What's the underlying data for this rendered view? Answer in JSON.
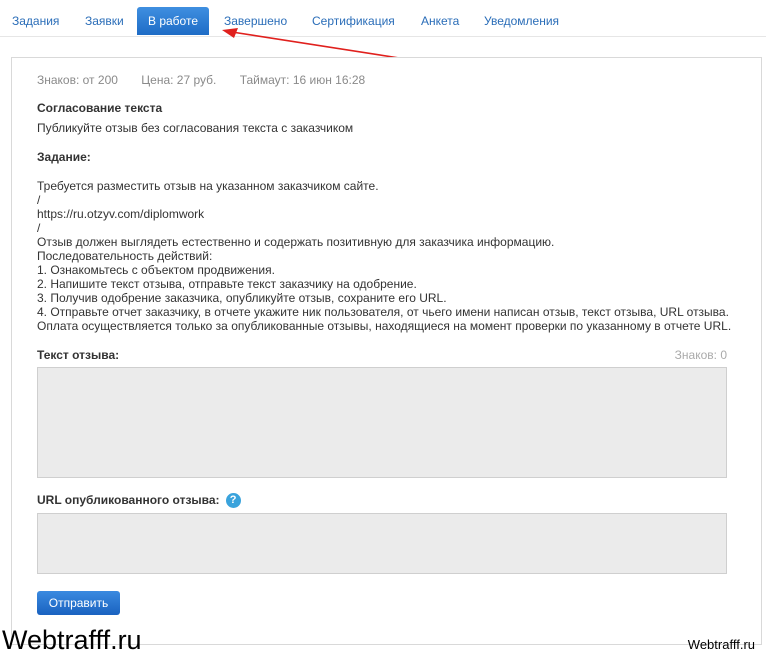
{
  "tabs": [
    {
      "label": "Задания"
    },
    {
      "label": "Заявки"
    },
    {
      "label": "В работе",
      "active": true
    },
    {
      "label": "Завершено"
    },
    {
      "label": "Сертификация"
    },
    {
      "label": "Анкета"
    },
    {
      "label": "Уведомления"
    }
  ],
  "accent_color": "#1e6cc6",
  "annotation_arrow_color": "#e0201d",
  "meta": {
    "chars": "Знаков: от 200",
    "price": "Цена: 27 руб.",
    "timeout": "Таймаут: 16 июн 16:28"
  },
  "approval": {
    "title": "Согласование текста",
    "text": "Публикуйте отзыв без согласования текста с заказчиком"
  },
  "task": {
    "title": "Задание:",
    "lines": [
      "Требуется разместить отзыв на указанном заказчиком сайте.",
      "/",
      "https://ru.otzyv.com/diplomwork",
      "/",
      "Отзыв должен выглядеть естественно и содержать позитивную для заказчика информацию.",
      "Последовательность действий:",
      "1. Ознакомьтесь с объектом продвижения.",
      "2. Напишите текст отзыва, отправьте текст заказчику на одобрение.",
      "3. Получив одобрение заказчика, опубликуйте отзыв, сохраните его URL.",
      "4. Отправьте отчет заказчику, в отчете укажите ник пользователя, от чьего имени написан отзыв, текст отзыва, URL отзыва.",
      "Оплата осуществляется только за опубликованные отзывы, находящиеся на момент проверки по указанному в отчете URL."
    ]
  },
  "review": {
    "label": "Текст отзыва:",
    "counter": "Знаков: 0",
    "value": ""
  },
  "url": {
    "label": "URL опубликованного отзыва:",
    "help_icon": "?",
    "value": ""
  },
  "submit_label": "Отправить",
  "watermark": {
    "left": "Webtrafff.ru",
    "right": "Webtrafff.ru"
  }
}
